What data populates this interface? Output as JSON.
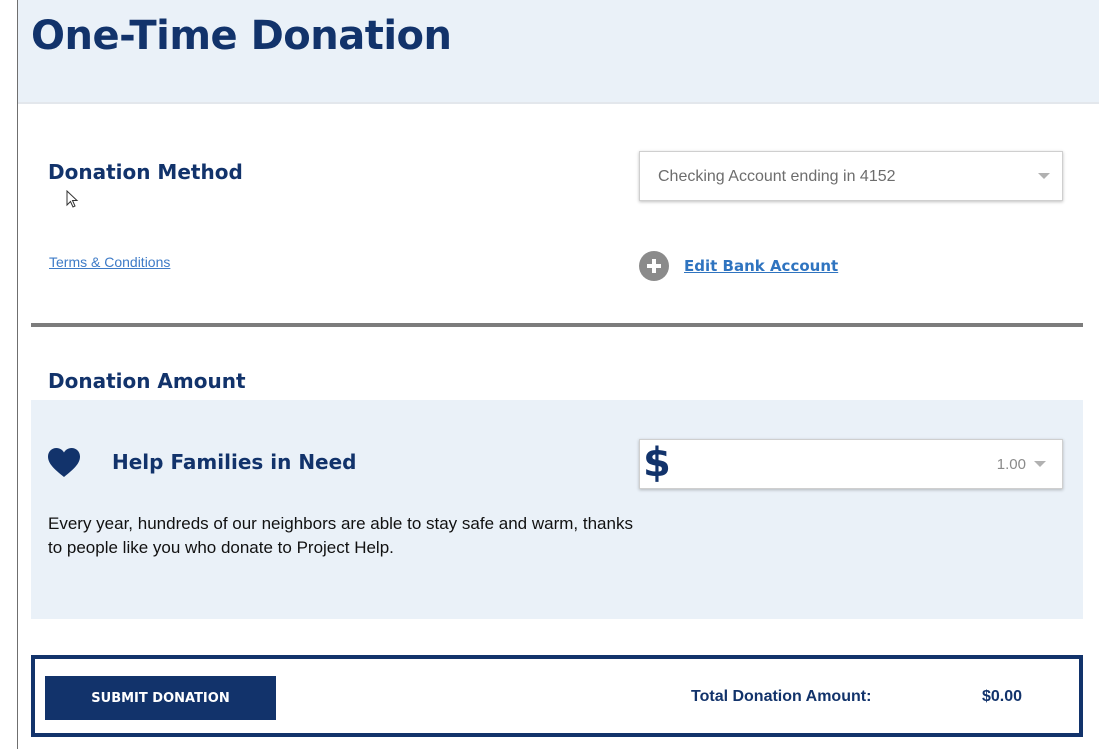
{
  "header": {
    "title": "One-Time Donation"
  },
  "donation_method": {
    "title": "Donation Method",
    "selected_account": "Checking Account ending in 4152",
    "terms_link": "Terms & Conditions",
    "edit_bank_label": "Edit Bank Account"
  },
  "donation_amount": {
    "title": "Donation Amount",
    "cause": {
      "title": "Help Families in Need",
      "description": "Every year, hundreds of our neighbors are able to stay safe and warm, thanks to people like you who donate to Project Help.",
      "currency_symbol": "$",
      "amount": "1.00"
    }
  },
  "footer": {
    "submit_label": "SUBMIT DONATION",
    "total_label": "Total Donation Amount:",
    "total_value": "$0.00"
  },
  "icons": {
    "plus": "plus-circle-icon",
    "heart": "heart-icon",
    "caret": "chevron-down-icon",
    "cursor": "mouse-pointer-icon"
  },
  "colors": {
    "brand_navy": "#12336b",
    "panel_bg": "#eaf1f8",
    "link_blue": "#2f74c0"
  }
}
